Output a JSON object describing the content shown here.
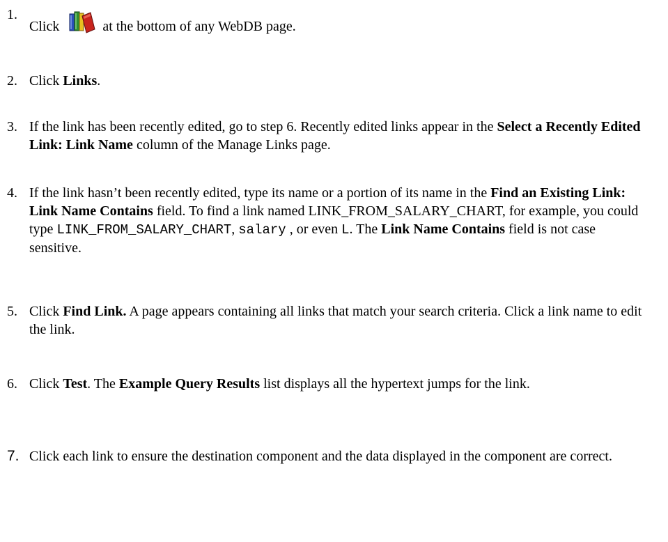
{
  "steps": [
    {
      "number": "1.",
      "before": "Click ",
      "icon": "books-icon",
      "after": " at the bottom of any WebDB page."
    },
    {
      "number": "2.",
      "t1": "Click ",
      "b1": "Links",
      "t2": "."
    },
    {
      "number": "3.",
      "t1": "If the link has been recently edited, go to step 6. Recently edited links appear in the ",
      "b1": "Select a Recently Edited Link: Link Name",
      "t2": " column of the Manage Links page."
    },
    {
      "number": "4.",
      "t1": "If the link hasn’t been recently edited, type its name or a portion of its name in the ",
      "b1": "Find an Existing Link: Link Name Contains",
      "t2": " field. To find a link named LINK_FROM_SALARY_CHART, for example, you could type ",
      "code1": "LINK_FROM_SALARY_CHART",
      "t3": ", ",
      "code2": "salary",
      "t4": " , or even ",
      "code3": "L",
      "t5": ".  The ",
      "b2": "Link Name Contains",
      "t6": " field is not case sensitive."
    },
    {
      "number": "5.",
      "t1": "Click ",
      "b1": "Find Link.",
      "t2": "  A page appears containing all links that match your search criteria.  Click a link name to edit the link."
    },
    {
      "number": "6.",
      "t1": "Click ",
      "b1": "Test",
      "t2": ". The ",
      "b2": "Example Query Results",
      "t3": " list displays all the hypertext jumps for the link."
    },
    {
      "number": "7.",
      "t1": "Click each link to ensure the destination component and the data displayed in the component are correct."
    }
  ],
  "colors": {
    "text": "#000000",
    "background": "#ffffff",
    "icon_red": "#c8241c",
    "icon_green": "#2f8f2f",
    "icon_blue": "#2a4fb8",
    "icon_yellow": "#e8c020"
  }
}
